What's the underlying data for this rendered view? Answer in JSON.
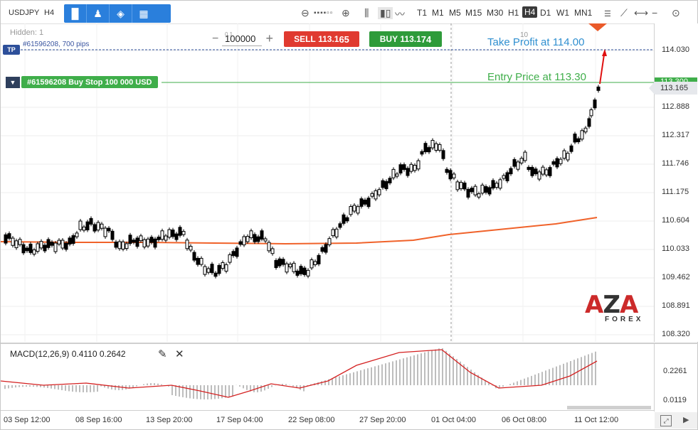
{
  "toolbar": {
    "symbol": "USDJPY",
    "period": "H4",
    "timeframes": [
      "T1",
      "M1",
      "M5",
      "M15",
      "M30",
      "H1",
      "H4",
      "D1",
      "W1",
      "MN1"
    ],
    "active_timeframe": "H4"
  },
  "trade_panel": {
    "hidden_label": "Hidden: 1",
    "quantity": "100000",
    "quantity_hint": "0.1",
    "sell_label": "SELL",
    "sell_price_prefix": "113.1",
    "sell_price_big": "65",
    "buy_label": "BUY",
    "buy_price_prefix": "113.1",
    "buy_price_big": "74"
  },
  "orders": {
    "tp_tag": "TP",
    "tp_text": "#61596208, 700 pips",
    "order_label": "#61596208 Buy Stop 100 000 USD",
    "cursor_top_value": "10"
  },
  "annotations": {
    "take_profit": "Take Profit at 114.00",
    "entry_price": "Entry Price at 113.30"
  },
  "price_axis": {
    "labels": [
      "114.030",
      "112.888",
      "112.317",
      "111.746",
      "111.175",
      "110.604",
      "110.033",
      "109.462",
      "108.891",
      "108.320"
    ],
    "current_price": "113.165",
    "entry_level": "113.300"
  },
  "macd": {
    "title": "MACD(12,26,9) 0.4110 0.2642",
    "labels": [
      "0.2261",
      "0.0119"
    ]
  },
  "time_axis": {
    "labels": [
      "03 Sep 12:00",
      "08 Sep 16:00",
      "13 Sep 20:00",
      "17 Sep 04:00",
      "22 Sep 08:00",
      "27 Sep 20:00",
      "01 Oct 04:00",
      "06 Oct 08:00",
      "11 Oct 12:00"
    ]
  },
  "logo": {
    "a1": "A",
    "z": "Z",
    "a2": "A",
    "sub": "FOREX"
  },
  "colors": {
    "sell": "#e03a30",
    "buy": "#2e9b3a",
    "ma_line": "#f0622a",
    "tp_line": "#2d4f9a",
    "entry_line": "#3fae4a",
    "arrow": "#e01010"
  }
}
